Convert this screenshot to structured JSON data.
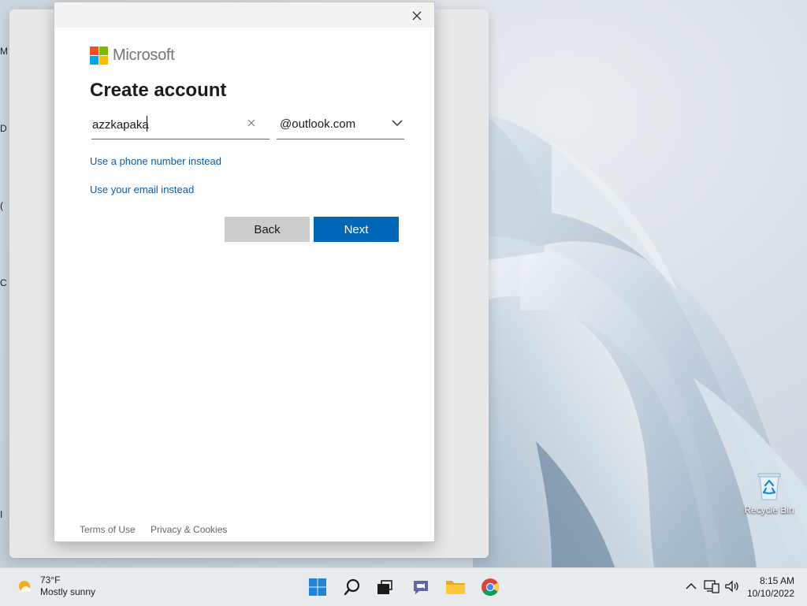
{
  "desktop": {
    "recycle_bin_label": "Recycle Bin",
    "edge_icon_letters": [
      "M",
      "D",
      "(",
      "C",
      "I"
    ]
  },
  "dialog": {
    "brand": "Microsoft",
    "title": "Create account",
    "username": {
      "value": "azzkapaka",
      "placeholder": ""
    },
    "domain": {
      "selected": "@outlook.com"
    },
    "links": {
      "phone": "Use a phone number instead",
      "email": "Use your email instead"
    },
    "buttons": {
      "back": "Back",
      "next": "Next"
    },
    "footer": {
      "terms": "Terms of Use",
      "privacy": "Privacy & Cookies"
    }
  },
  "taskbar": {
    "weather": {
      "temp": "73°F",
      "condition": "Mostly sunny"
    },
    "apps": [
      "windows-start-icon",
      "search-icon",
      "task-view-icon",
      "teams-chat-icon",
      "file-explorer-icon",
      "chrome-icon"
    ],
    "clock": {
      "time": "8:15 AM",
      "date": "10/10/2022"
    }
  },
  "colors": {
    "accent": "#0067b8",
    "link": "#0b5a9e",
    "back_button": "#cccccc"
  }
}
